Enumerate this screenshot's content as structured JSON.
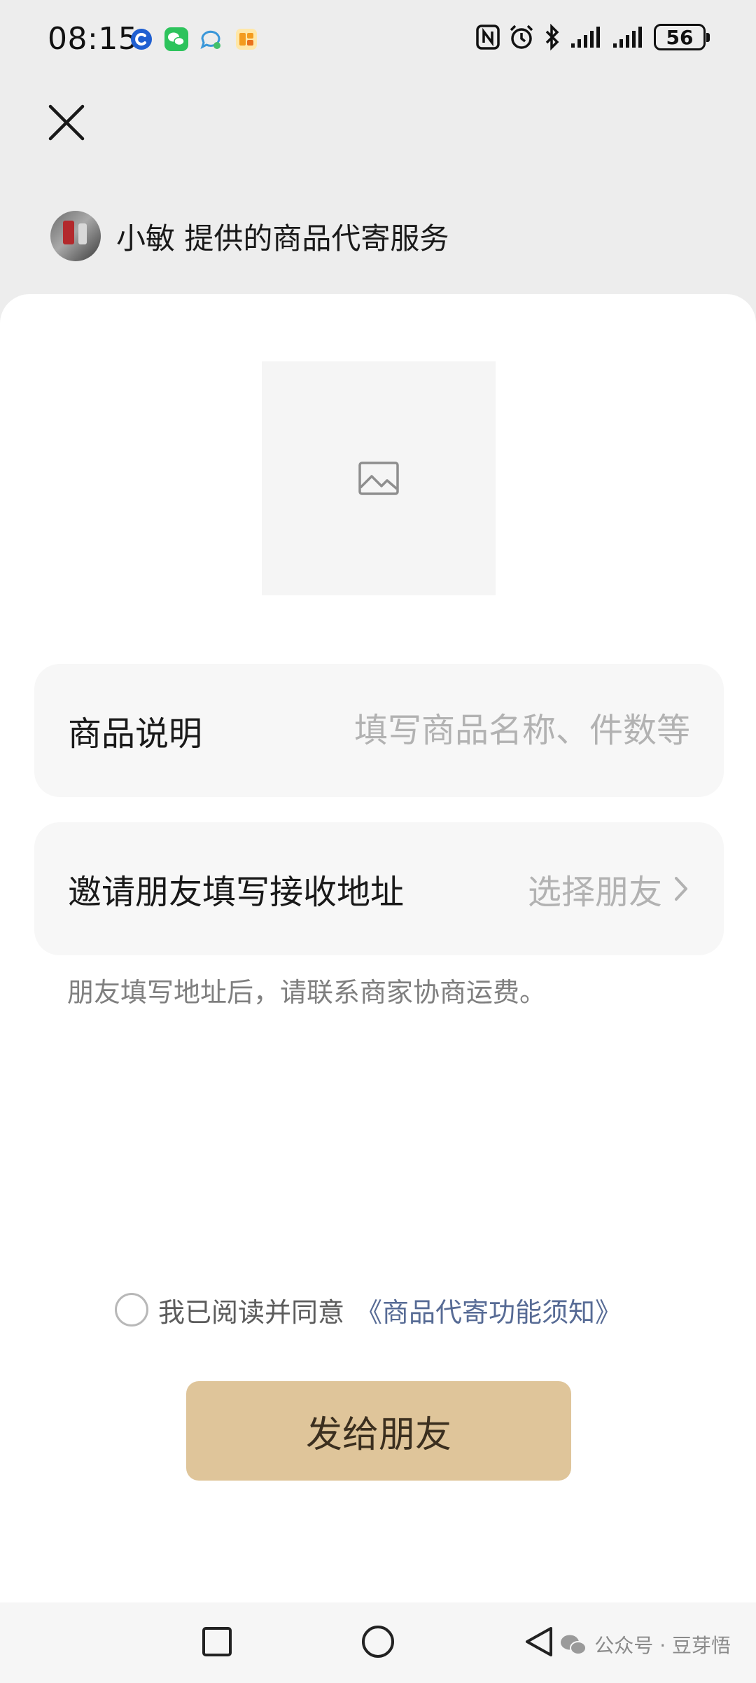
{
  "status_bar": {
    "time": "08:15",
    "battery": "56",
    "notification_icons": [
      "app-c-icon",
      "wechat-icon",
      "message-bubble-icon",
      "orange-app-icon"
    ],
    "system_icons": [
      "nfc-icon",
      "alarm-icon",
      "bluetooth-icon",
      "signal-icon",
      "signal-icon",
      "battery-icon"
    ]
  },
  "header": {
    "close_icon": "close-icon",
    "title": "小敏 提供的商品代寄服务"
  },
  "sheet": {
    "image_placeholder_icon": "image-icon",
    "description": {
      "label": "商品说明",
      "placeholder": "填写商品名称、件数等"
    },
    "invite": {
      "label": "邀请朋友填写接收地址",
      "value": "选择朋友",
      "chevron": "chevron-right-icon"
    },
    "hint": "朋友填写地址后，请联系商家协商运费。",
    "agreement": {
      "text": "我已阅读并同意",
      "link": "《商品代寄功能须知》",
      "checked": false
    },
    "send_button": "发给朋友"
  },
  "nav_bar": {
    "icons": [
      "square-recent-icon",
      "circle-home-icon",
      "triangle-back-icon"
    ],
    "watermark": "公众号 · 豆芽悟"
  },
  "colors": {
    "background": "#ededed",
    "sheet": "#ffffff",
    "field": "#f7f7f7",
    "button": "#dfc59a",
    "link": "#576b95",
    "placeholder": "#b2b2b2"
  }
}
